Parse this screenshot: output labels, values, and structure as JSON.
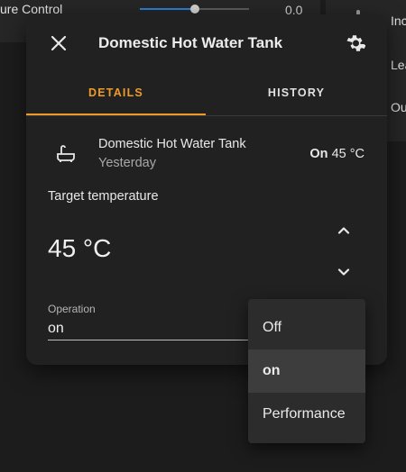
{
  "background": {
    "left_card": {
      "slider_label": "ure Control",
      "slider_value": "0.0",
      "slider_level": 0.5
    },
    "right_card": {
      "rows": [
        {
          "label": "Inc",
          "icon": "thermometer-icon"
        },
        {
          "label": "Lea",
          "icon": "thermometer-icon"
        },
        {
          "label": "Ou",
          "icon": "thermometer-icon"
        }
      ]
    }
  },
  "dialog": {
    "title": "Domestic Hot Water Tank",
    "close_icon": "close-icon",
    "settings_icon": "gear-icon",
    "tabs": [
      {
        "label": "DETAILS",
        "active": true
      },
      {
        "label": "HISTORY",
        "active": false
      }
    ],
    "entity": {
      "icon": "water-heater-icon",
      "name": "Domestic Hot Water Tank",
      "last_changed": "Yesterday",
      "state": "On",
      "current_temp": "45 °C"
    },
    "target": {
      "label": "Target temperature",
      "value": "45 °C",
      "up_icon": "chevron-up-icon",
      "down_icon": "chevron-down-icon"
    },
    "operation": {
      "label": "Operation",
      "value": "on",
      "options": [
        {
          "label": "Off",
          "selected": false
        },
        {
          "label": "on",
          "selected": true
        },
        {
          "label": "Performance",
          "selected": false
        }
      ]
    }
  },
  "colors": {
    "accent": "#ef9a28",
    "slider": "#2a7fd6",
    "dialog_bg": "#212121",
    "page_bg": "#1c1c1c"
  }
}
